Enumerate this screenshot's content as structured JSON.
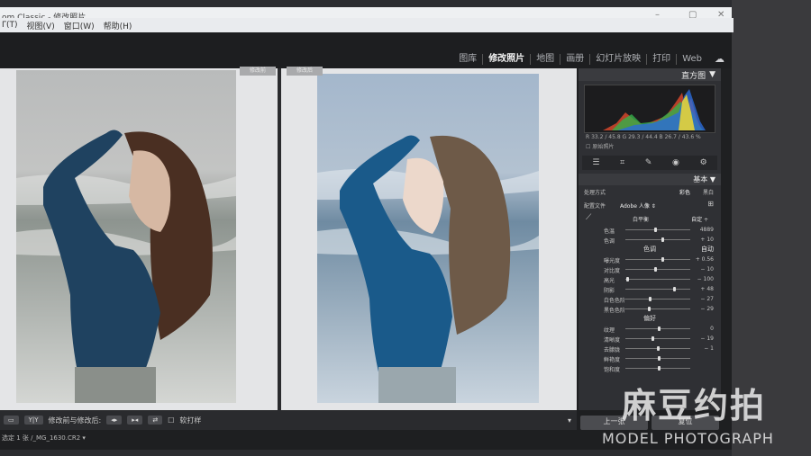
{
  "window": {
    "title": "om Classic - 修改照片",
    "controls": [
      "–",
      "▢",
      "✕"
    ]
  },
  "menu": [
    "Γ(T)",
    "视图(V)",
    "窗口(W)",
    "帮助(H)"
  ],
  "modules": [
    {
      "label": "图库",
      "active": false
    },
    {
      "label": "修改照片",
      "active": true
    },
    {
      "label": "地图",
      "active": false
    },
    {
      "label": "画册",
      "active": false
    },
    {
      "label": "幻灯片放映",
      "active": false
    },
    {
      "label": "打印",
      "active": false
    },
    {
      "label": "Web",
      "active": false
    }
  ],
  "viewer": {
    "before_tag": "修改前",
    "after_tag": "修改后"
  },
  "histogram": {
    "header": "直方图",
    "rgb_readout": "R 33.2 / 45.8  G 29.3 / 44.4  B 26.7 / 43.6 %",
    "original_photo_label": "原始照片"
  },
  "basic": {
    "header": "基本",
    "treatment_label": "处理方式",
    "treatment_color": "彩色",
    "treatment_bw": "黑白",
    "profile_label": "配置文件",
    "profile_value": "Adobe 人像 ⇕",
    "wb_label": "白平衡",
    "wb_value": "自定 ÷",
    "tone_label": "色调",
    "tone_auto": "自动",
    "presence_label": "偏好",
    "sliders": [
      {
        "label": "色温",
        "value": "4889",
        "pos": 0.45
      },
      {
        "label": "色调",
        "value": "+ 10",
        "pos": 0.55
      },
      {
        "label": "曝光度",
        "value": "+ 0.56",
        "pos": 0.55
      },
      {
        "label": "对比度",
        "value": "− 10",
        "pos": 0.45
      },
      {
        "label": "高光",
        "value": "− 100",
        "pos": 0.02
      },
      {
        "label": "阴影",
        "value": "+ 48",
        "pos": 0.74
      },
      {
        "label": "白色色阶",
        "value": "− 27",
        "pos": 0.36
      },
      {
        "label": "黑色色阶",
        "value": "− 29",
        "pos": 0.35
      },
      {
        "label": "纹理",
        "value": "0",
        "pos": 0.5
      },
      {
        "label": "清晰度",
        "value": "− 19",
        "pos": 0.4
      },
      {
        "label": "去朦胧",
        "value": "− 1",
        "pos": 0.49
      },
      {
        "label": "鲜艳度",
        "value": "",
        "pos": 0.5
      },
      {
        "label": "饱和度",
        "value": "",
        "pos": 0.5
      }
    ]
  },
  "bottom": {
    "view_toggle": "Y|Y",
    "mode_label": "修改前与修改后:",
    "soft_proof": "软打样",
    "prev_button": "上一张",
    "reset_button": "复位"
  },
  "filmstrip": {
    "selection": "选定 1 张 /_MG_1630.CR2 ▾"
  },
  "watermark": {
    "cn": "麻豆约拍",
    "en": "MODEL PHOTOGRAPH"
  }
}
